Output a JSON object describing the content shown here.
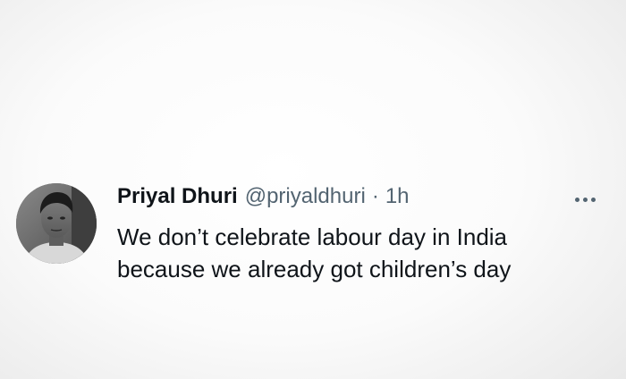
{
  "tweet": {
    "author_name": "Priyal Dhuri",
    "handle": "@priyaldhuri",
    "separator": "·",
    "time": "1h",
    "text_lines": [
      "We don’t celebrate labour day in India",
      "because we already got children’s day"
    ],
    "more_icon": "more-horizontal-icon",
    "avatar": "profile-photo"
  },
  "colors": {
    "text_primary": "#0f1419",
    "text_secondary": "#536471"
  }
}
